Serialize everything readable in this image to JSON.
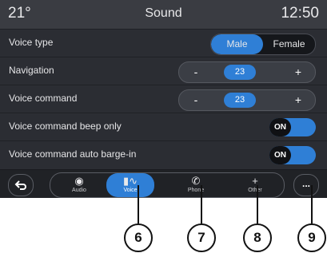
{
  "header": {
    "temperature": "21°",
    "title": "Sound",
    "time": "12:50"
  },
  "rows": {
    "voice_type": {
      "label": "Voice type",
      "options": [
        "Male",
        "Female"
      ],
      "selected": "Male"
    },
    "navigation": {
      "label": "Navigation",
      "minus": "-",
      "value": "23",
      "plus": "+"
    },
    "voice_command": {
      "label": "Voice command",
      "minus": "-",
      "value": "23",
      "plus": "+"
    },
    "beep_only": {
      "label": "Voice command beep only",
      "state": "ON"
    },
    "barge_in": {
      "label": "Voice command auto barge-in",
      "state": "ON"
    }
  },
  "navbar": {
    "back_icon": "back-arrow-icon",
    "tabs": [
      {
        "label": "Audio",
        "icon": "audio-icon",
        "active": false
      },
      {
        "label": "Voice",
        "icon": "voice-icon",
        "active": true
      },
      {
        "label": "Phone",
        "icon": "phone-icon",
        "active": false
      },
      {
        "label": "Other",
        "icon": "plus-icon",
        "active": false
      }
    ],
    "more": "..."
  },
  "callouts": [
    "6",
    "7",
    "8",
    "9"
  ],
  "colors": {
    "accent": "#2f7fd6",
    "background": "#2b2d33",
    "header": "#3a3c42"
  }
}
